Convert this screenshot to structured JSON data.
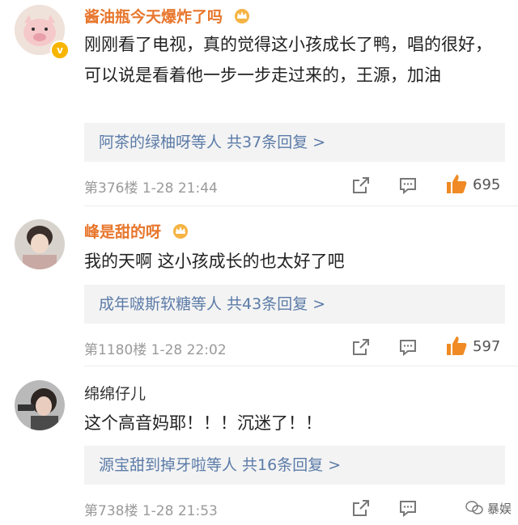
{
  "comments": [
    {
      "username": "酱油瓶今天爆炸了吗",
      "text": "刚刚看了电视，真的觉得这小孩成长了鸭，唱的很好，可以说是看着他一步一步走过来的，王源，加油",
      "replies": "阿茶的绿柚呀等人  共37条回复 >",
      "floor_time": "第376楼  1-28  21:44",
      "likes": "695",
      "vip": true
    },
    {
      "username": "峰是甜的呀",
      "text": "我的天啊 这小孩成长的也太好了吧",
      "replies": "成年啵斯软糖等人  共43条回复 >",
      "floor_time": "第1180楼  1-28  22:02",
      "likes": "597",
      "vip": true
    },
    {
      "username": "绵绵仔儿",
      "text": "这个高音妈耶！！！沉迷了！！",
      "replies": "源宝甜到掉牙啦等人  共16条回复 >",
      "floor_time": "第738楼  1-28  21:53",
      "likes": "",
      "vip": false
    }
  ],
  "watermark": "暴娱",
  "colors": {
    "username_vip": "#e8762c",
    "reply_link": "#5b7ba8",
    "like_icon": "#f08a24"
  }
}
